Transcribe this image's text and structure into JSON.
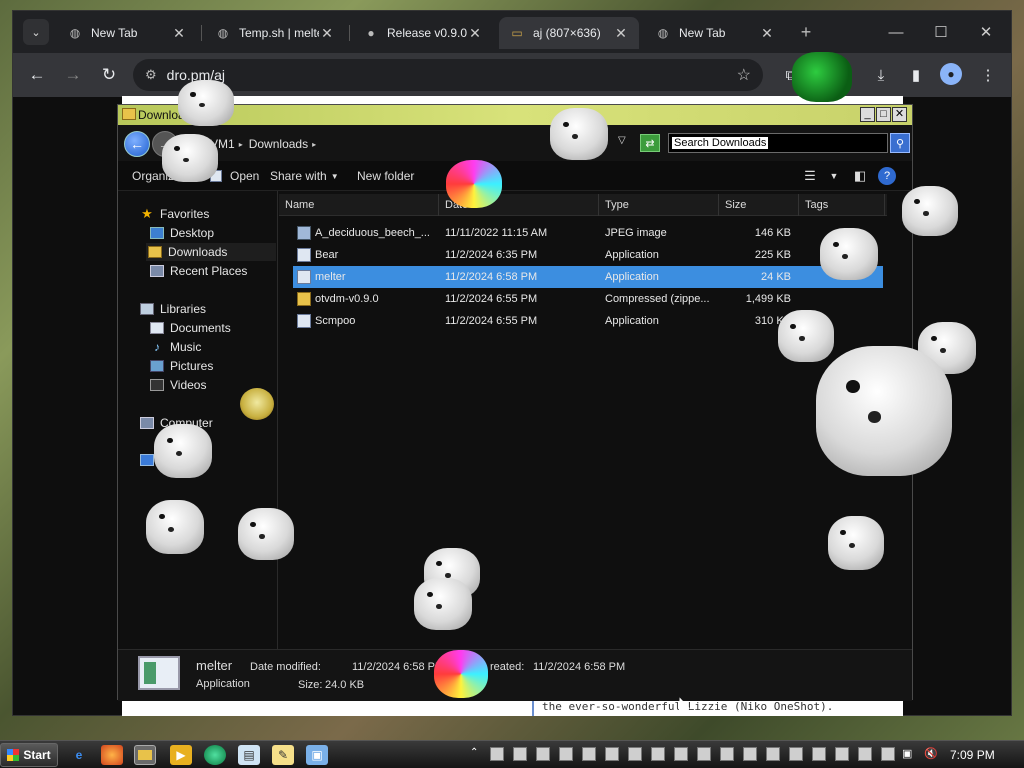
{
  "browser": {
    "tabs": [
      {
        "title": "New Tab",
        "favicon": "globe-icon"
      },
      {
        "title": "Temp.sh | melte",
        "favicon": "globe-icon"
      },
      {
        "title": "Release v0.9.0",
        "favicon": "github-icon"
      },
      {
        "title": "aj (807×636)",
        "favicon": "image-icon"
      },
      {
        "title": "New Tab",
        "favicon": "globe-icon"
      }
    ],
    "active_tab": 3,
    "url": "dro.pm/aj",
    "page_footer_text": "the ever-so-wonderful Lizzie (Niko OneShot)."
  },
  "explorer": {
    "title": "Downloads",
    "breadcrumb": [
      "VM1",
      "Downloads"
    ],
    "search_placeholder": "Search Downloads",
    "commands": {
      "organize": "Organize",
      "open": "Open",
      "share_with": "Share with",
      "new_folder": "New folder"
    },
    "nav": {
      "favorites_header": "Favorites",
      "favorites": [
        "Desktop",
        "Downloads",
        "Recent Places"
      ],
      "libraries_header": "Libraries",
      "libraries": [
        "Documents",
        "Music",
        "Pictures",
        "Videos"
      ],
      "computer": "Computer"
    },
    "columns": {
      "name": "Name",
      "date": "Date",
      "type": "Type",
      "size": "Size",
      "tags": "Tags"
    },
    "files": [
      {
        "name": "A_deciduous_beech_...",
        "date": "11/11/2022 11:15 AM",
        "type": "JPEG image",
        "size": "146 KB",
        "icon": "image-file-icon",
        "selected": false
      },
      {
        "name": "Bear",
        "date": "11/2/2024 6:35 PM",
        "type": "Application",
        "size": "225 KB",
        "icon": "application-icon",
        "selected": false
      },
      {
        "name": "melter",
        "date": "11/2/2024 6:58 PM",
        "type": "Application",
        "size": "24 KB",
        "icon": "application-icon",
        "selected": true
      },
      {
        "name": "otvdm-v0.9.0",
        "date": "11/2/2024 6:55 PM",
        "type": "Compressed (zippe...",
        "size": "1,499 KB",
        "icon": "zip-folder-icon",
        "selected": false
      },
      {
        "name": "Scmpoo",
        "date": "11/2/2024 6:55 PM",
        "type": "Application",
        "size": "310 KB",
        "icon": "application-icon",
        "selected": false
      }
    ],
    "details": {
      "name": "melter",
      "kind": "Application",
      "date_modified_label": "Date modified:",
      "date_modified": "11/2/2024 6:58 PM",
      "size_label": "Size:",
      "size": "24.0 KB",
      "created_label": "Date created:",
      "created_visible": "reated:",
      "created": "11/2/2024 6:58 PM"
    }
  },
  "taskbar": {
    "start_label": "Start",
    "clock": "7:09 PM"
  },
  "colors": {
    "selection": "#3c8ee0",
    "chrome_dark": "#202124",
    "explorer_title": "#c8d26a"
  }
}
